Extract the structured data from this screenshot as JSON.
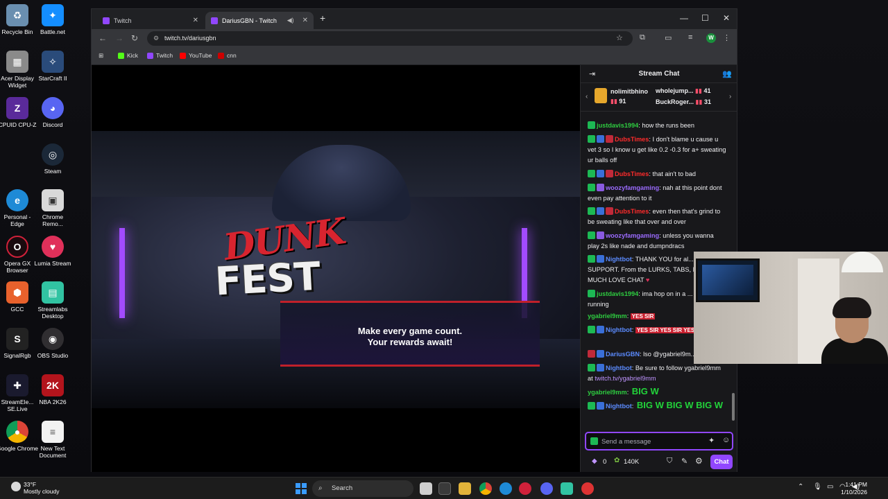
{
  "desktop": {
    "icons": [
      {
        "label": "Recycle Bin",
        "icon": "recycle-bin-icon",
        "color": "#6a8fb0"
      },
      {
        "label": "Battle.net",
        "icon": "battlenet-icon",
        "color": "#148eff"
      },
      {
        "label": "Acer Display Widget",
        "icon": "acer-display-icon",
        "color": "#8a8a8a"
      },
      {
        "label": "StarCraft II",
        "icon": "starcraft-icon",
        "color": "#2a4b7a"
      },
      {
        "label": "CPUID CPU-Z",
        "icon": "cpuz-icon",
        "color": "#5a2a9a"
      },
      {
        "label": "Discord",
        "icon": "discord-icon",
        "color": "#5865f2"
      },
      {
        "label": "Steam",
        "icon": "steam-icon",
        "color": "#1b2838"
      },
      {
        "label": "Personal - Edge",
        "icon": "edge-icon",
        "color": "#1e8ad6"
      },
      {
        "label": "Chrome Remo...",
        "icon": "chrome-remote-icon",
        "color": "#d9d9d9"
      },
      {
        "label": "Opera GX Browser",
        "icon": "opera-gx-icon",
        "color": "#d0213a"
      },
      {
        "label": "Lumia Stream",
        "icon": "lumia-icon",
        "color": "#e0305a"
      },
      {
        "label": "GCC",
        "icon": "gcc-icon",
        "color": "#e8612c"
      },
      {
        "label": "Streamlabs Desktop",
        "icon": "streamlabs-icon",
        "color": "#31c3a2"
      },
      {
        "label": "SignalRgb",
        "icon": "signalrgb-icon",
        "color": "#222"
      },
      {
        "label": "OBS Studio",
        "icon": "obs-icon",
        "color": "#302e31"
      },
      {
        "label": "StreamEle... SE.Live",
        "icon": "streamelements-icon",
        "color": "#1a1a2e"
      },
      {
        "label": "NBA 2K26",
        "icon": "nba2k-icon",
        "color": "#b3141c"
      },
      {
        "label": "Google Chrome",
        "icon": "chrome-icon",
        "color": "#e9b800"
      },
      {
        "label": "New Text Document",
        "icon": "text-document-icon",
        "color": "#f2f2f2"
      }
    ]
  },
  "browser": {
    "tabs": [
      {
        "label": "Twitch",
        "active": false
      },
      {
        "label": "DariusGBN - Twitch",
        "active": true
      }
    ],
    "url": "twitch.tv/dariusgbn",
    "profile_initial": "W",
    "bookmarks": [
      {
        "label": "Kick",
        "color": "#53fc18"
      },
      {
        "label": "Twitch",
        "color": "#9147ff"
      },
      {
        "label": "YouTube",
        "color": "#ff0000"
      },
      {
        "label": "cnn",
        "color": "#cc0000"
      }
    ]
  },
  "stream": {
    "logo_top": "DUNK",
    "logo_bottom": "FEST",
    "banner_line1": "Make every game count.",
    "banner_line2": "Your rewards await!"
  },
  "chat": {
    "title": "Stream Chat",
    "leaders": [
      {
        "name": "nolimitbhino",
        "count": "91"
      },
      {
        "name": "wholejump...",
        "count": "41"
      },
      {
        "name": "BuckRoger...",
        "count": "31"
      }
    ],
    "messages": [
      {
        "user": "justdavis1994",
        "color": "green",
        "text": "how the runs been"
      },
      {
        "user": "DubsTimes",
        "color": "red",
        "text": "I don't blame u cause u vet 3 so I know u get like 0.2 -0.3 for a+ sweating ur balls off"
      },
      {
        "user": "DubsTimes",
        "color": "red",
        "text": "that ain't to bad"
      },
      {
        "user": "woozyfamgaming",
        "color": "purple",
        "text": "nah at this point dont even pay attention to it"
      },
      {
        "user": "DubsTimes",
        "color": "red",
        "text": "even then that's grind to be sweating like that over and over"
      },
      {
        "user": "woozyfamgaming",
        "color": "purple",
        "text": "unless you wanna play 2s like nade and dumpndracs"
      },
      {
        "user": "Nightbot",
        "color": "blue",
        "text": "THANK YOU for al... SUPPORT. From the LURKS, TABS, FOLLOWS! MUCH LOVE CHAT"
      },
      {
        "user": "justdavis1994",
        "color": "green",
        "text": "ima hop on in a ... you still running"
      },
      {
        "user": "ygabriel9mm",
        "color": "green",
        "text": "YES SIR"
      },
      {
        "user": "Nightbot",
        "color": "blue",
        "text": "YES SIR YES SIR YES SIR"
      },
      {
        "user": "DariusGBN",
        "color": "blue",
        "text": "lso @ygabriel9m..."
      },
      {
        "user": "Nightbot",
        "color": "blue",
        "text": "Be sure to follow ygabriel9mm at",
        "link": "twitch.tv/ygabriel9mm"
      },
      {
        "user": "ygabriel9mm",
        "color": "green",
        "text": "BIG W"
      },
      {
        "user": "Nightbot",
        "color": "blue",
        "text": "BIG W BIG W BIG W"
      }
    ],
    "input_placeholder": "Send a message",
    "points": "0",
    "channel_points": "140K",
    "chat_button": "Chat"
  },
  "taskbar": {
    "temperature": "33°F",
    "condition": "Mostly cloudy",
    "search_label": "Search",
    "time": "1:41 PM",
    "date": "1/10/2026"
  }
}
